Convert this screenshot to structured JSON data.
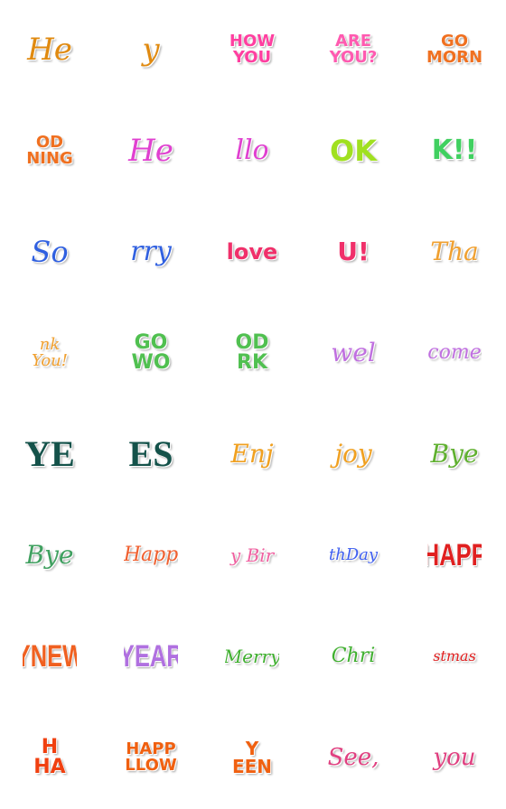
{
  "tiles": [
    {
      "lines": [
        "He"
      ],
      "color": "#e08a10",
      "style": "script",
      "size": 34
    },
    {
      "lines": [
        "y"
      ],
      "color": "#e08a10",
      "style": "script",
      "size": 34
    },
    {
      "lines": [
        "HOW",
        "YOU"
      ],
      "color": "#ff3fa0",
      "style": "bold",
      "size": 18
    },
    {
      "lines": [
        "ARE",
        "YOU?"
      ],
      "color": "#ff5ab0",
      "style": "bold",
      "size": 18
    },
    {
      "lines": [
        "GO",
        "MORN"
      ],
      "color": "#f07020",
      "style": "bold",
      "size": 18
    },
    {
      "lines": [
        "OD",
        "NING"
      ],
      "color": "#f07020",
      "style": "bold",
      "size": 18
    },
    {
      "lines": [
        "He"
      ],
      "color": "#e040d0",
      "style": "script",
      "size": 34
    },
    {
      "lines": [
        "llo"
      ],
      "color": "#e040d0",
      "style": "script",
      "size": 30
    },
    {
      "lines": [
        "OK"
      ],
      "color": "#a0e020",
      "style": "bold",
      "size": 32
    },
    {
      "lines": [
        "K!!"
      ],
      "color": "#40d060",
      "style": "bold",
      "size": 30
    },
    {
      "lines": [
        "So"
      ],
      "color": "#3060e0",
      "style": "script",
      "size": 32
    },
    {
      "lines": [
        "rry"
      ],
      "color": "#3060e0",
      "style": "script",
      "size": 30
    },
    {
      "lines": [
        "love"
      ],
      "color": "#f0306a",
      "style": "bold",
      "size": 24
    },
    {
      "lines": [
        "U!"
      ],
      "color": "#f0306a",
      "style": "bold",
      "size": 28
    },
    {
      "lines": [
        "Tha"
      ],
      "color": "#f0a030",
      "style": "script",
      "size": 28
    },
    {
      "lines": [
        "nk",
        "You!"
      ],
      "color": "#f0a030",
      "style": "script",
      "size": 18
    },
    {
      "lines": [
        "GO",
        "WO"
      ],
      "color": "#50c050",
      "style": "bold",
      "size": 22
    },
    {
      "lines": [
        "OD",
        "RK"
      ],
      "color": "#50c050",
      "style": "bold",
      "size": 22
    },
    {
      "lines": [
        "wel"
      ],
      "color": "#c070e0",
      "style": "script",
      "size": 28
    },
    {
      "lines": [
        "come"
      ],
      "color": "#c070e0",
      "style": "script",
      "size": 22
    },
    {
      "lines": [
        "YE"
      ],
      "color": "#14524a",
      "style": "serif",
      "size": 40
    },
    {
      "lines": [
        "ES"
      ],
      "color": "#14524a",
      "style": "serif",
      "size": 40
    },
    {
      "lines": [
        "Enj"
      ],
      "color": "#f0a020",
      "style": "script",
      "size": 28
    },
    {
      "lines": [
        "joy"
      ],
      "color": "#f0a020",
      "style": "script",
      "size": 28
    },
    {
      "lines": [
        "Bye"
      ],
      "color": "#60b030",
      "style": "script",
      "size": 28
    },
    {
      "lines": [
        "Bye"
      ],
      "color": "#40a060",
      "style": "script",
      "size": 28
    },
    {
      "lines": [
        "Happ"
      ],
      "color": "#f06030",
      "style": "script",
      "size": 22
    },
    {
      "lines": [
        "y Bir"
      ],
      "color": "#f060a0",
      "style": "script",
      "size": 20
    },
    {
      "lines": [
        "thDay"
      ],
      "color": "#4060f0",
      "style": "script",
      "size": 18
    },
    {
      "lines": [
        "HAPP"
      ],
      "color": "#e02020",
      "style": "cond",
      "size": 34
    },
    {
      "lines": [
        "YNEW"
      ],
      "color": "#f06020",
      "style": "cond",
      "size": 34
    },
    {
      "lines": [
        "YEAR"
      ],
      "color": "#b070e0",
      "style": "cond",
      "size": 34
    },
    {
      "lines": [
        "Merry"
      ],
      "color": "#40b030",
      "style": "script",
      "size": 20
    },
    {
      "lines": [
        "Chri"
      ],
      "color": "#40b030",
      "style": "script",
      "size": 22
    },
    {
      "lines": [
        "stmas"
      ],
      "color": "#e02020",
      "style": "script",
      "size": 16
    },
    {
      "lines": [
        "H",
        "HA"
      ],
      "color": "#f04010",
      "style": "bold",
      "size": 22
    },
    {
      "lines": [
        "HAPP",
        "LLOW"
      ],
      "color": "#f06010",
      "style": "bold",
      "size": 18
    },
    {
      "lines": [
        "Y",
        "EEN"
      ],
      "color": "#f06010",
      "style": "bold",
      "size": 20
    },
    {
      "lines": [
        "See,"
      ],
      "color": "#e04080",
      "style": "script",
      "size": 26
    },
    {
      "lines": [
        "you"
      ],
      "color": "#e04080",
      "style": "script",
      "size": 26
    }
  ]
}
